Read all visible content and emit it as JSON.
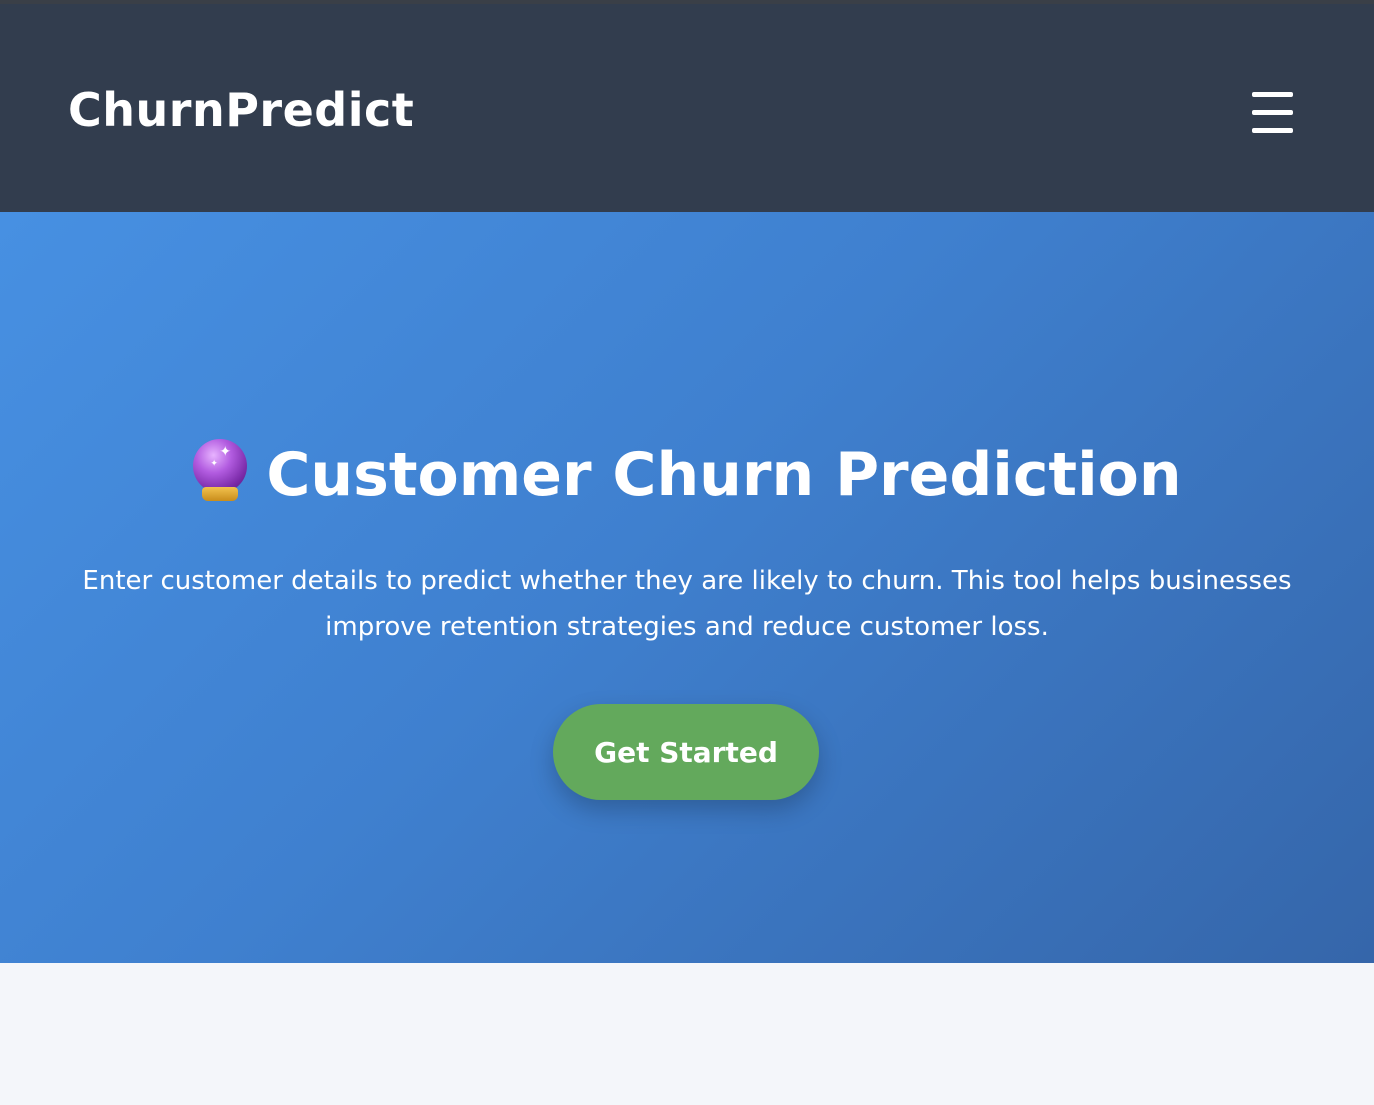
{
  "navbar": {
    "brand": "ChurnPredict",
    "menu_icon": "hamburger-menu-icon",
    "background_color": "#323d4e"
  },
  "hero": {
    "icon": "crystal-ball-icon",
    "title": "Customer Churn Prediction",
    "description": "Enter customer details to predict whether they are likely to churn. This tool helps businesses improve retention strategies and reduce customer loss.",
    "cta_label": "Get Started",
    "gradient_start_color": "#4790e2",
    "gradient_end_color": "#3566aa",
    "cta_color": "#63a95c"
  },
  "page": {
    "background_color": "#f4f6fa"
  }
}
